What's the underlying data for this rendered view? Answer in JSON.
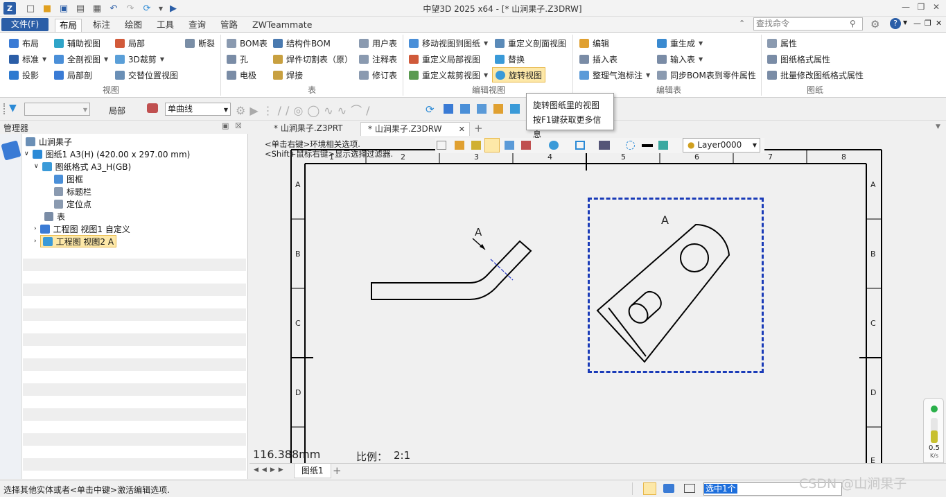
{
  "window": {
    "title": "中望3D 2025 x64 - [* 山涧果子.Z3DRW]"
  },
  "menu": {
    "file": "文件(F)",
    "tabs": [
      "布局",
      "标注",
      "绘图",
      "工具",
      "查询",
      "管路",
      "ZWTeammate"
    ],
    "search_placeholder": "查找命令"
  },
  "ribbon": {
    "view_group": {
      "label": "视图",
      "items": [
        "布局",
        "辅助视图",
        "局部",
        "断裂",
        "标准",
        "全剖视图",
        "3D裁剪",
        "投影",
        "局部剖",
        "交替位置视图"
      ]
    },
    "table_group": {
      "label": "表",
      "items": [
        "BOM表",
        "结构件BOM",
        "用户表",
        "孔",
        "焊件切割表（原）",
        "注释表",
        "电极",
        "焊接",
        "修订表"
      ]
    },
    "editview_group": {
      "label": "编辑视图",
      "items": [
        "移动视图到图纸",
        "重定义剖面视图",
        "重定义局部视图",
        "替换",
        "重定义裁剪视图",
        "旋转视图"
      ]
    },
    "edittable_group": {
      "label": "编辑表",
      "items": [
        "编辑",
        "重生成",
        "插入表",
        "输入表",
        "整理气泡标注",
        "同步BOM表到零件属性"
      ]
    },
    "sheet_group": {
      "label": "图纸",
      "items": [
        "属性",
        "图纸格式属性",
        "批量修改图纸格式属性"
      ]
    }
  },
  "tooltip": {
    "line1": "旋转图纸里的视图",
    "line2": "按F1键获取更多信息"
  },
  "toolbar2": {
    "local_label": "局部",
    "curve_select": "单曲线"
  },
  "manager": {
    "title": "管理器",
    "tree": [
      "山涧果子",
      "图纸1 A3(H) (420.00 x 297.00 mm)",
      "图纸格式 A3_H(GB)",
      "图框",
      "标题栏",
      "定位点",
      "表",
      "工程图 视图1 自定义",
      "工程图 视图2 A"
    ]
  },
  "doc_tabs": [
    "* 山涧果子.Z3PRT",
    "* 山涧果子.Z3DRW"
  ],
  "canvas": {
    "hint1": "<单击右键>环境相关选项.",
    "hint2": "<Shift+鼠标右键>显示选择过滤器.",
    "layer": "Layer0000",
    "col_labels": [
      "1",
      "2",
      "3",
      "4",
      "5",
      "6",
      "7",
      "8"
    ],
    "row_labels": [
      "A",
      "B",
      "C",
      "D",
      "E"
    ],
    "view_label_a": "A",
    "section_label_a": "A",
    "measure": "116.388mm",
    "scale_label": "比例：",
    "scale_value": "2:1"
  },
  "sheet_tab": "图纸1",
  "gauge": {
    "value": "0.5",
    "unit": "K/s"
  },
  "status": {
    "message": "选择其他实体或者<单击中键>激活编辑选项.",
    "selection": "选中1个",
    "watermark": "CSDN @山涧果子"
  }
}
